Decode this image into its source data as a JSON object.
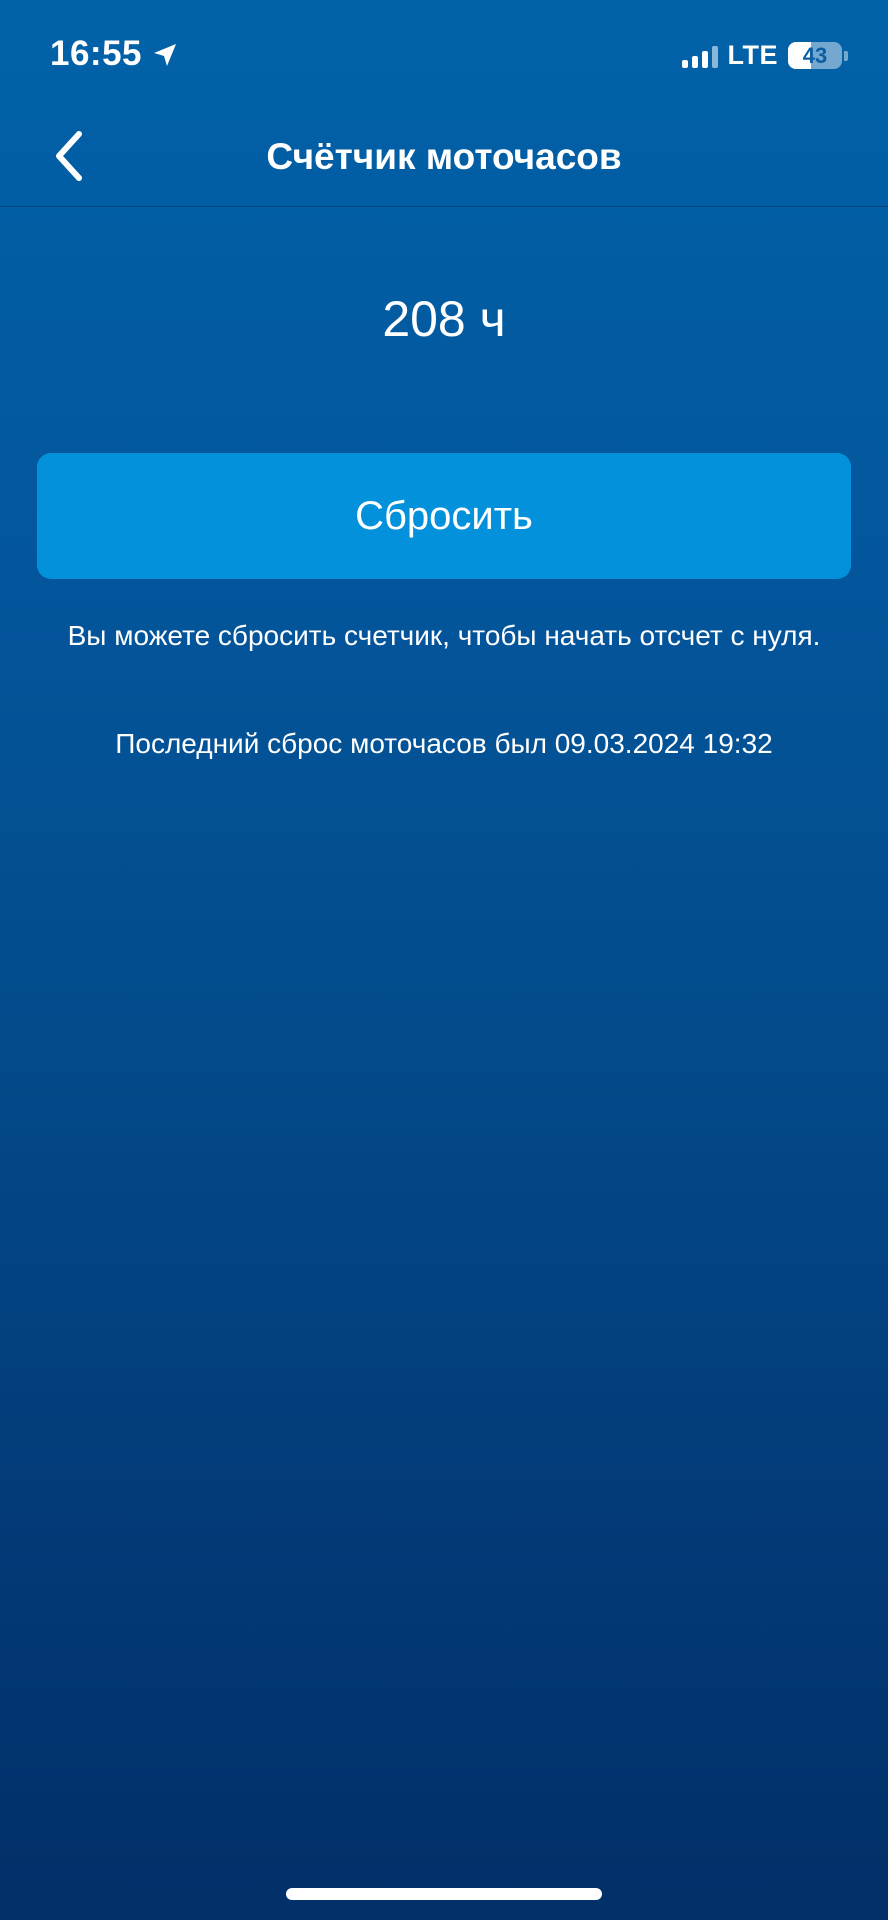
{
  "status_bar": {
    "time": "16:55",
    "location_icon": "location-arrow-icon",
    "signal_icon": "cellular-signal-icon",
    "network": "LTE",
    "battery_icon": "battery-icon",
    "battery_level": "43"
  },
  "nav": {
    "back_icon": "chevron-left-icon",
    "title": "Счётчик моточасов"
  },
  "counter": {
    "value": "208 ч"
  },
  "actions": {
    "reset_label": "Сбросить"
  },
  "info": {
    "hint": "Вы можете сбросить счетчик, чтобы начать отсчет с нуля.",
    "last_reset": "Последний сброс моточасов был 09.03.2024 19:32"
  },
  "colors": {
    "background_top": "#0262a8",
    "background_bottom": "#022f68",
    "button": "#0491db",
    "text": "#ffffff"
  }
}
